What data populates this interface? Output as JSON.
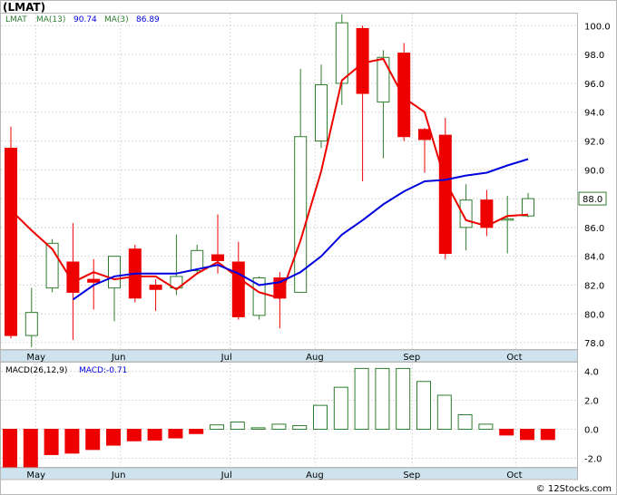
{
  "chart_data": [
    {
      "type": "candlestick",
      "title": "(LMAT)",
      "legend": {
        "symbol": "LMAT",
        "ma_long_label": "MA(13)",
        "ma_long_value": "90.74",
        "ma_short_label": "MA(3)",
        "ma_short_value": "86.89"
      },
      "colors": {
        "up": "#2e7d2e",
        "down": "#ee0000",
        "ma_long": "#0000dd",
        "ma_short": "#ee0000"
      },
      "months": [
        "May",
        "Jun",
        "Jul",
        "Aug",
        "Sep",
        "Oct"
      ],
      "ylim": [
        77.5,
        100.9
      ],
      "yticks": [
        "78.0",
        "80.0",
        "82.0",
        "84.0",
        "86.0",
        "88.0",
        "90.0",
        "92.0",
        "94.0",
        "96.0",
        "98.0",
        "100.0"
      ],
      "last_price_label": "88.0",
      "candles": [
        {
          "o": 91.5,
          "h": 93.0,
          "l": 78.3,
          "c": 78.5
        },
        {
          "o": 78.5,
          "h": 81.8,
          "l": 77.7,
          "c": 80.1
        },
        {
          "o": 81.8,
          "h": 85.2,
          "l": 81.5,
          "c": 84.9
        },
        {
          "o": 83.6,
          "h": 86.3,
          "l": 78.2,
          "c": 81.5
        },
        {
          "o": 82.4,
          "h": 83.8,
          "l": 80.3,
          "c": 82.2
        },
        {
          "o": 81.8,
          "h": 84.0,
          "l": 79.5,
          "c": 84.0
        },
        {
          "o": 84.5,
          "h": 84.8,
          "l": 80.8,
          "c": 81.1
        },
        {
          "o": 82.0,
          "h": 82.4,
          "l": 80.2,
          "c": 81.7
        },
        {
          "o": 81.8,
          "h": 85.5,
          "l": 81.3,
          "c": 82.6
        },
        {
          "o": 83.0,
          "h": 84.8,
          "l": 82.8,
          "c": 84.4
        },
        {
          "o": 84.1,
          "h": 86.9,
          "l": 82.8,
          "c": 83.7
        },
        {
          "o": 83.6,
          "h": 85.0,
          "l": 79.6,
          "c": 79.8
        },
        {
          "o": 79.9,
          "h": 82.6,
          "l": 79.6,
          "c": 82.5
        },
        {
          "o": 82.5,
          "h": 82.9,
          "l": 79.0,
          "c": 81.1
        },
        {
          "o": 81.5,
          "h": 97.0,
          "l": 81.5,
          "c": 92.3
        },
        {
          "o": 92.0,
          "h": 97.3,
          "l": 91.5,
          "c": 95.9
        },
        {
          "o": 96.0,
          "h": 100.8,
          "l": 94.5,
          "c": 100.2
        },
        {
          "o": 99.8,
          "h": 100.0,
          "l": 89.2,
          "c": 95.3
        },
        {
          "o": 94.7,
          "h": 98.3,
          "l": 90.8,
          "c": 97.8
        },
        {
          "o": 98.1,
          "h": 98.8,
          "l": 92.0,
          "c": 92.3
        },
        {
          "o": 92.8,
          "h": 92.9,
          "l": 89.8,
          "c": 92.1
        },
        {
          "o": 92.4,
          "h": 93.6,
          "l": 83.8,
          "c": 84.2
        },
        {
          "o": 86.0,
          "h": 89.0,
          "l": 84.4,
          "c": 87.9
        },
        {
          "o": 87.9,
          "h": 88.6,
          "l": 85.4,
          "c": 86.0
        },
        {
          "o": 86.6,
          "h": 88.2,
          "l": 84.2,
          "c": 86.6
        },
        {
          "o": 86.8,
          "h": 88.4,
          "l": 86.7,
          "c": 88.0
        }
      ],
      "ma_long": [
        null,
        null,
        null,
        81.0,
        82.0,
        82.6,
        82.8,
        82.8,
        82.8,
        83.1,
        83.4,
        82.8,
        82.0,
        82.2,
        82.9,
        84.0,
        85.5,
        86.5,
        87.6,
        88.5,
        89.2,
        89.3,
        89.6,
        89.8,
        90.3,
        90.74
      ],
      "ma_short": [
        87.2,
        85.8,
        84.5,
        82.2,
        82.9,
        82.4,
        82.6,
        82.6,
        81.7,
        82.8,
        83.6,
        82.5,
        81.5,
        81.1,
        85.1,
        89.9,
        96.2,
        97.4,
        97.7,
        95.0,
        94.0,
        89.2,
        86.5,
        86.1,
        86.8,
        86.89
      ]
    },
    {
      "type": "bar",
      "legend": {
        "label": "MACD(26,12,9)",
        "value_label": "MACD:-0.71"
      },
      "colors": {
        "positive": "#2e7d2e",
        "negative": "#ee0000"
      },
      "ylim": [
        -2.6,
        4.6
      ],
      "yticks": [
        "4.0",
        "2.0",
        "0.0",
        "-2.0"
      ],
      "values": [
        -2.6,
        -2.6,
        -1.75,
        -1.65,
        -1.4,
        -1.1,
        -0.8,
        -0.75,
        -0.6,
        -0.3,
        0.3,
        0.5,
        0.1,
        0.35,
        0.25,
        1.65,
        2.9,
        4.2,
        4.2,
        4.2,
        3.3,
        2.35,
        1.0,
        0.35,
        -0.4,
        -0.71,
        -0.71
      ]
    }
  ],
  "footer": {
    "credit": "© 12Stocks.com"
  }
}
